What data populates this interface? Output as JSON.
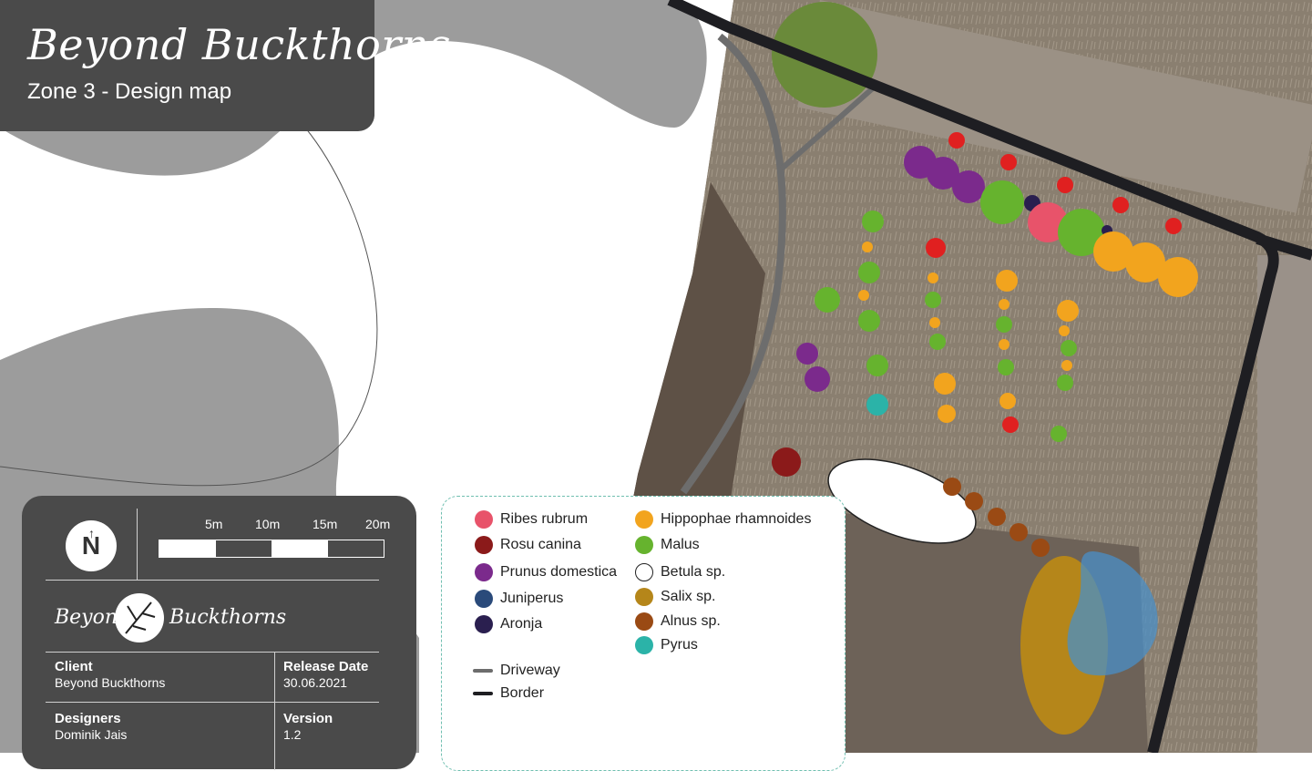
{
  "header": {
    "title": "Beyond Buckthorns",
    "subtitle": "Zone 3 - Design map"
  },
  "info": {
    "north_label": "N",
    "scale_labels": [
      "5m",
      "10m",
      "15m",
      "20m"
    ],
    "logo_left": "Beyond",
    "logo_right": "Buckthorns",
    "client_label": "Client",
    "client_value": "Beyond Buckthorns",
    "release_label": "Release Date",
    "release_value": "30.06.2021",
    "designers_label": "Designers",
    "designers_value": "Dominik Jais",
    "version_label": "Version",
    "version_value": "1.2"
  },
  "legend": {
    "plants": [
      {
        "name": "Ribes rubrum",
        "color": "#e8536a"
      },
      {
        "name": "Rosu canina",
        "color": "#8b1a1a"
      },
      {
        "name": "Prunus domestica",
        "color": "#7b2a8c"
      },
      {
        "name": "Juniperus",
        "color": "#2a4a7a"
      },
      {
        "name": "Aronja",
        "color": "#2a1f4f"
      },
      {
        "name": "Hippophae rhamnoides",
        "color": "#f2a41e"
      },
      {
        "name": "Malus",
        "color": "#66b32e"
      },
      {
        "name": "Betula sp.",
        "color": "#ffffff"
      },
      {
        "name": "Salix sp.",
        "color": "#b5861a"
      },
      {
        "name": "Alnus sp.",
        "color": "#9a4a14"
      },
      {
        "name": "Pyrus",
        "color": "#2bb3a8"
      }
    ],
    "lines": [
      {
        "name": "Driveway",
        "color": "#6d6d6d"
      },
      {
        "name": "Border",
        "color": "#1e1e22"
      }
    ]
  },
  "colors": {
    "panel": "#4a4a4a",
    "red_dot": "#e02020"
  }
}
